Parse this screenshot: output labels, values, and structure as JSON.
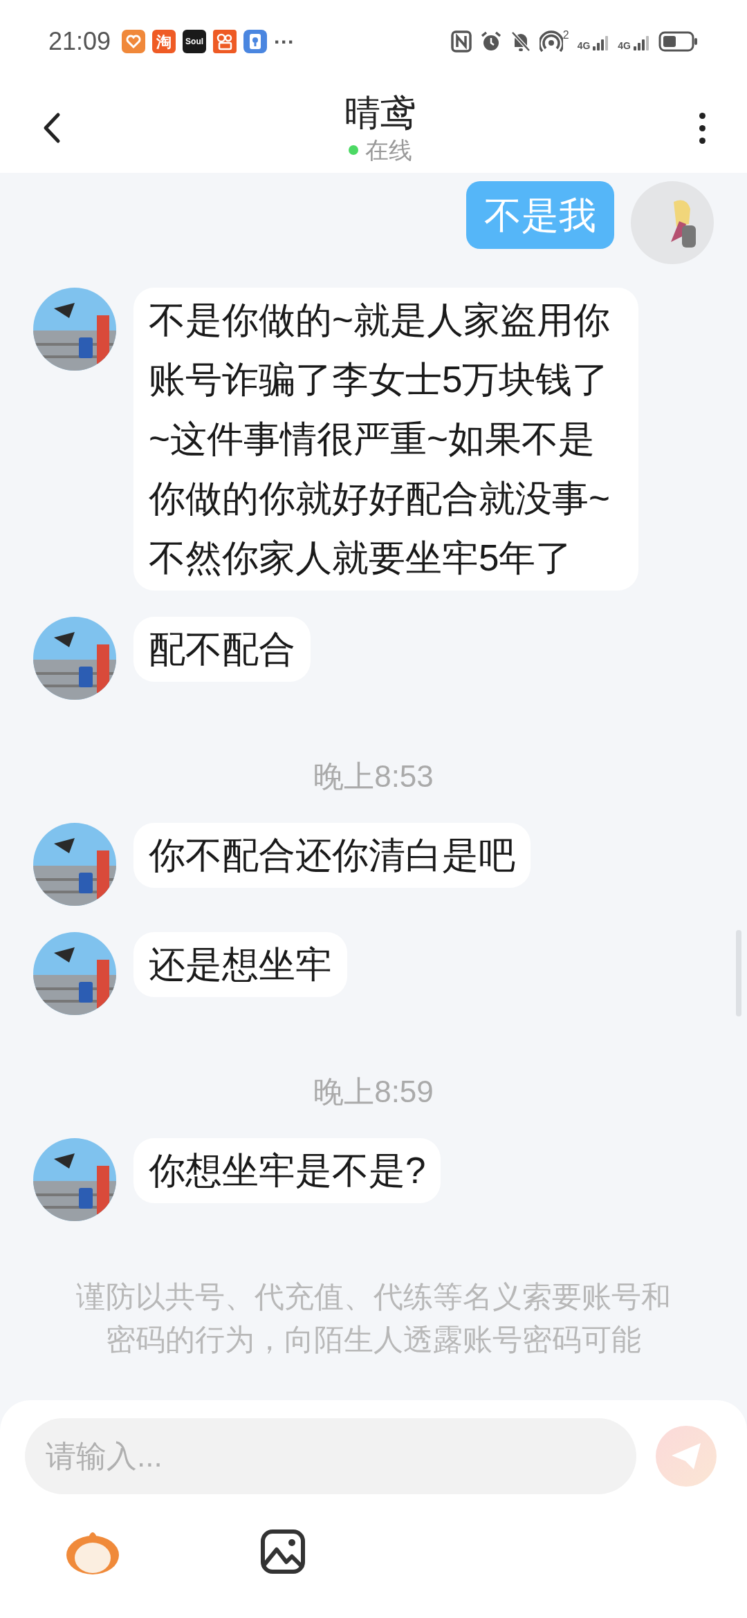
{
  "status_bar": {
    "time": "21:09",
    "apps": [
      {
        "kind": "heart",
        "color": "#f0883a"
      },
      {
        "kind": "text",
        "label": "淘",
        "color": "#ef5b25"
      },
      {
        "kind": "text",
        "label": "Soul",
        "color": "#1a1a1a"
      },
      {
        "kind": "camera",
        "color": "#ee5a24"
      },
      {
        "kind": "bulb",
        "color": "#4a86e0"
      }
    ],
    "more": "···",
    "hotspot_count": "2",
    "sims": [
      {
        "tag": "4G"
      },
      {
        "tag": "4G"
      }
    ]
  },
  "header": {
    "title": "晴鸢",
    "status": "在线",
    "online": true
  },
  "messages": [
    {
      "kind": "sent",
      "text": "不是我"
    },
    {
      "kind": "received",
      "text": "不是你做的~就是人家盗用你账号诈骗了李女士5万块钱了~这件事情很严重~如果不是你做的你就好好配合就没事~不然你家人就要坐牢5年了"
    },
    {
      "kind": "received",
      "text": "配不配合"
    },
    {
      "kind": "time",
      "text": "晚上8:53"
    },
    {
      "kind": "received",
      "text": "你不配合还你清白是吧"
    },
    {
      "kind": "received",
      "text": "还是想坐牢"
    },
    {
      "kind": "time",
      "text": "晚上8:59"
    },
    {
      "kind": "received",
      "text": "你想坐牢是不是?"
    }
  ],
  "notice": "谨防以共号、代充值、代练等名义索要账号和密码的行为，向陌生人透露账号密码可能",
  "composer": {
    "placeholder": "请输入..."
  }
}
